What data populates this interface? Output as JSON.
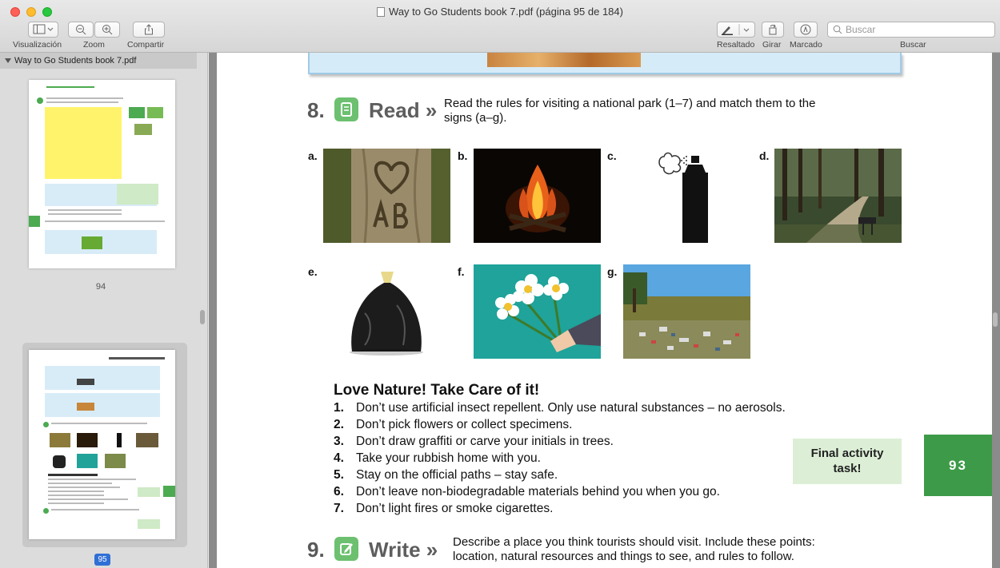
{
  "window": {
    "title": "Way to Go Students book  7.pdf (página 95 de 184)"
  },
  "toolbar": {
    "view_label": "Visualización",
    "zoom_label": "Zoom",
    "share_label": "Compartir",
    "highlight_label": "Resaltado",
    "rotate_label": "Girar",
    "markup_label": "Marcado",
    "search_label": "Buscar",
    "search_placeholder": "Buscar"
  },
  "sidebar": {
    "document_name": "Way to Go Students book  7.pdf",
    "pages": [
      {
        "number": "94",
        "selected": false
      },
      {
        "number": "95",
        "selected": true
      }
    ]
  },
  "document": {
    "exercise8": {
      "number": "8.",
      "word": "Read",
      "chevron": "»",
      "instruction_line1": "Read the rules for visiting a national park (1–7) and match them to the",
      "instruction_line2": "signs (a–g)."
    },
    "signs": [
      {
        "letter": "a.",
        "subject": "heart-initials-carved-in-tree"
      },
      {
        "letter": "b.",
        "subject": "campfire"
      },
      {
        "letter": "c.",
        "subject": "aerosol-spray-can"
      },
      {
        "letter": "d.",
        "subject": "forest-path"
      },
      {
        "letter": "e.",
        "subject": "rubbish-bag"
      },
      {
        "letter": "f.",
        "subject": "hand-holding-flowers"
      },
      {
        "letter": "g.",
        "subject": "litter-in-field"
      }
    ],
    "rules_title": "Love Nature! Take Care of it!",
    "rules": [
      {
        "n": "1.",
        "text": "Don’t use artificial insect repellent. Only use natural substances – no aerosols."
      },
      {
        "n": "2.",
        "text": "Don’t pick flowers or collect specimens."
      },
      {
        "n": "3.",
        "text": "Don’t draw graffiti or carve your initials in trees."
      },
      {
        "n": "4.",
        "text": "Take your rubbish home with you."
      },
      {
        "n": "5.",
        "text": "Stay on the official paths – stay safe."
      },
      {
        "n": "6.",
        "text": "Don’t leave non-biodegradable materials behind you when you go."
      },
      {
        "n": "7.",
        "text": "Don’t light fires or smoke cigarettes."
      }
    ],
    "final_task_line1": "Final activity",
    "final_task_line2": "task!",
    "page_number": "93",
    "exercise9": {
      "number": "9.",
      "word": "Write",
      "chevron": "»",
      "instruction_line1": "Describe a place you think tourists should visit. Include these points:",
      "instruction_line2": "location, natural resources and things to see, and rules to follow."
    }
  },
  "colors": {
    "accent_green": "#3d9a48",
    "final_task_bg": "#dcefd6",
    "exercise_icon": "#6cc06f",
    "selected_page": "#2f6fd6"
  }
}
